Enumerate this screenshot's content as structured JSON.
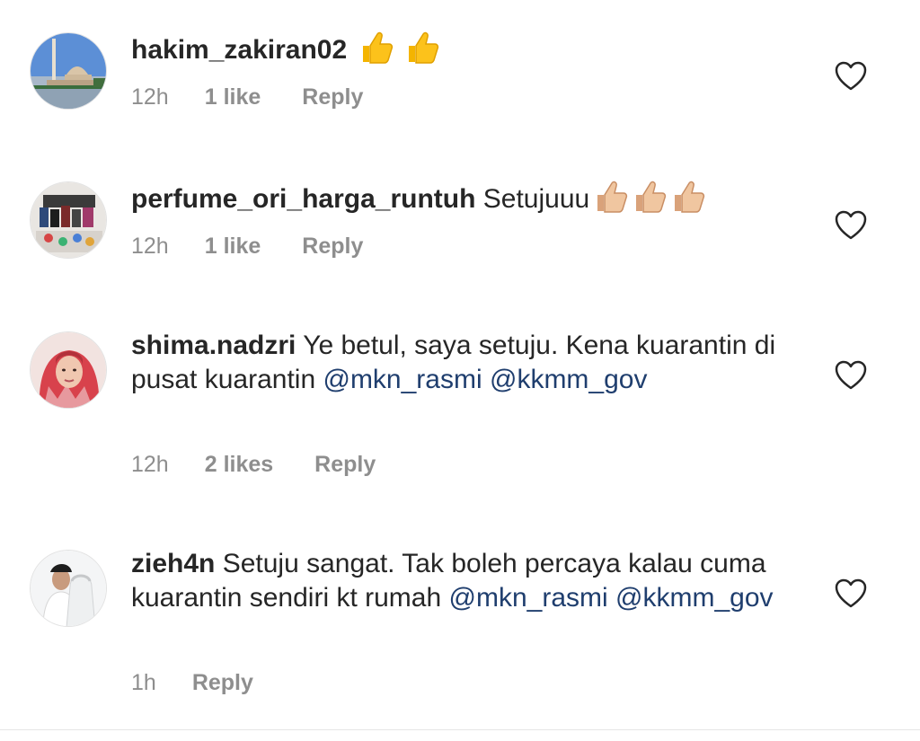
{
  "comments": [
    {
      "username": "hakim_zakiran02",
      "text": "",
      "emoji": "👍👍",
      "time": "12h",
      "likes": "1 like",
      "reply": "Reply",
      "avatar_icon": "mosque-photo-avatar"
    },
    {
      "username": "perfume_ori_harga_runtuh",
      "text": "Setujuuu",
      "emoji": "👍🏼👍🏼👍🏼",
      "time": "12h",
      "likes": "1 like",
      "reply": "Reply",
      "avatar_icon": "perfume-bottles-avatar"
    },
    {
      "username": "shima.nadzri",
      "text": "Ye betul, saya setuju. Kena kuarantin di pusat kuarantin",
      "mentions": [
        "@mkn_rasmi",
        "@kkmm_gov"
      ],
      "time": "12h",
      "likes": "2 likes",
      "reply": "Reply",
      "avatar_icon": "woman-hijab-avatar"
    },
    {
      "username": "zieh4n",
      "text": "Setuju sangat. Tak boleh percaya kalau cuma kuarantin sendiri kt rumah",
      "mentions": [
        "@mkn_rasmi",
        "@kkmm_gov"
      ],
      "time": "1h",
      "reply": "Reply",
      "avatar_icon": "couple-photo-avatar"
    }
  ],
  "icons": {
    "like": "heart-outline-icon"
  },
  "colors": {
    "text": "#262626",
    "meta": "#8e8e8e",
    "mention": "#1f3e6e"
  }
}
